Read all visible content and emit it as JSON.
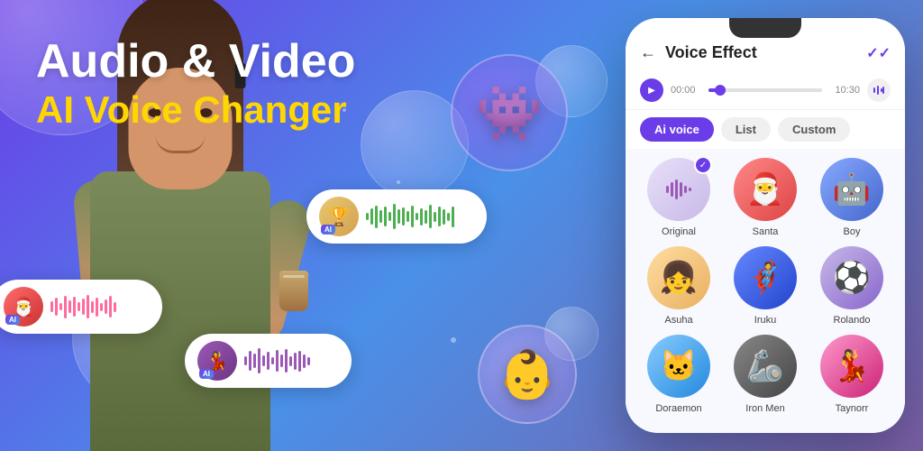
{
  "app": {
    "title": "Audio & Video AI Voice Changer"
  },
  "hero": {
    "title_line1": "Audio & Video",
    "title_line2": "AI Voice Changer"
  },
  "phone": {
    "screen_title": "Voice Effect",
    "back_label": "←",
    "check_label": "✓✓",
    "audio_time_start": "00:00",
    "audio_time_end": "10:30",
    "tabs": [
      {
        "id": "ai_voice",
        "label": "Ai voice",
        "active": true
      },
      {
        "id": "list",
        "label": "List",
        "active": false
      },
      {
        "id": "custom",
        "label": "Custom",
        "active": false
      }
    ],
    "voices": [
      {
        "id": "original",
        "name": "Original",
        "emoji": "🎵",
        "selected": true,
        "bg": "#e8e0f0"
      },
      {
        "id": "santa",
        "name": "Santa",
        "emoji": "🎅",
        "selected": false,
        "bg": "#ff6b6b"
      },
      {
        "id": "boy",
        "name": "Boy",
        "emoji": "🤖",
        "selected": false,
        "bg": "#74b9ff"
      },
      {
        "id": "asuha",
        "name": "Asuha",
        "emoji": "👧",
        "selected": false,
        "bg": "#fdcb6e"
      },
      {
        "id": "iruku",
        "name": "Iruku",
        "emoji": "🦸",
        "selected": false,
        "bg": "#55efc4"
      },
      {
        "id": "rolando",
        "name": "Rolando",
        "emoji": "⚽",
        "selected": false,
        "bg": "#a29bfe"
      },
      {
        "id": "doraemon",
        "name": "Doraemon",
        "emoji": "🐱",
        "selected": false,
        "bg": "#74b9ff"
      },
      {
        "id": "iron_men",
        "name": "Iron Men",
        "emoji": "🦾",
        "selected": false,
        "bg": "#636e72"
      },
      {
        "id": "taynorr",
        "name": "Taynorr",
        "emoji": "💃",
        "selected": false,
        "bg": "#fd79a8"
      }
    ]
  },
  "waveform_cards": [
    {
      "id": "card1",
      "color": "green",
      "ai_label": "AI"
    },
    {
      "id": "card2",
      "color": "pink",
      "ai_label": "AI"
    },
    {
      "id": "card3",
      "color": "purple",
      "ai_label": "AI"
    }
  ],
  "colors": {
    "primary": "#6a3de8",
    "accent": "#FFD700",
    "bg_gradient_start": "#6a3de8",
    "bg_gradient_end": "#4a90e8"
  }
}
